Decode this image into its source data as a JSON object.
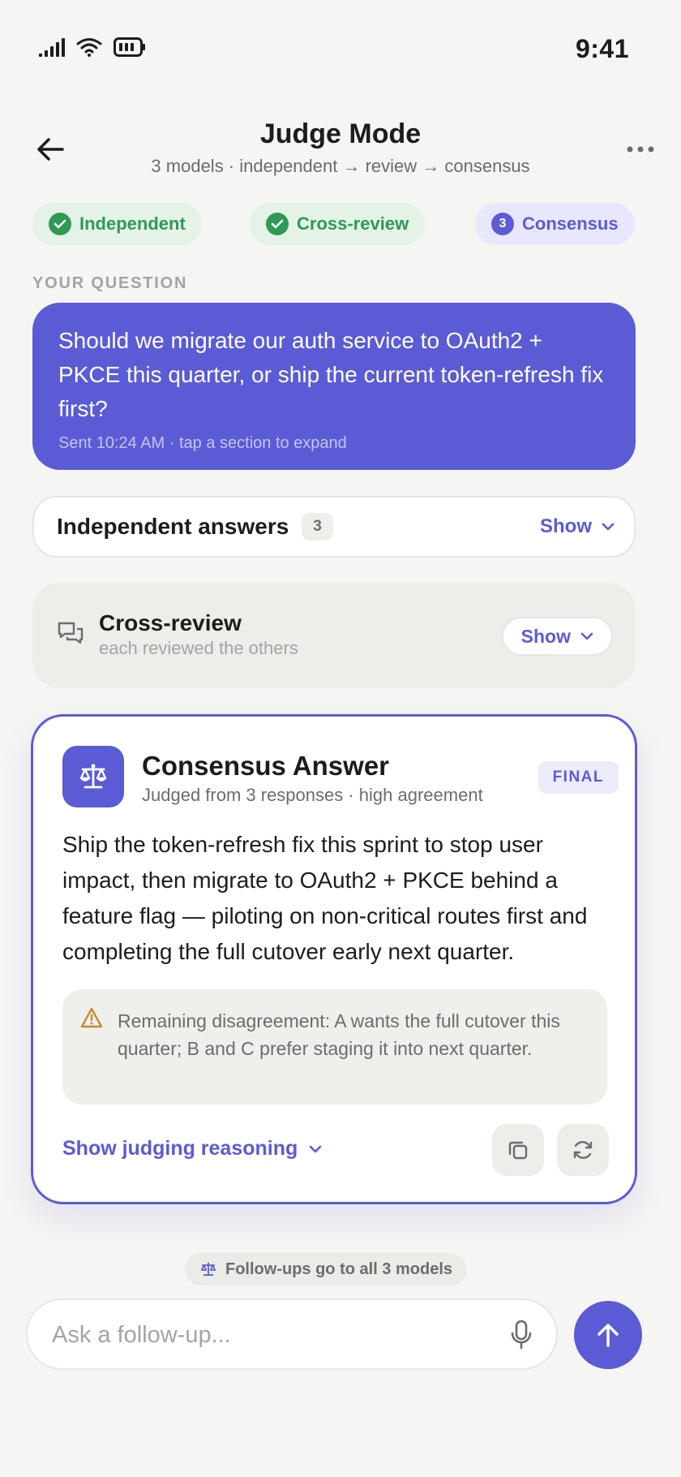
{
  "status_bar": {
    "time": "9:41"
  },
  "header": {
    "title": "Judge Mode",
    "subtitle": "3 models · independent → review → consensus"
  },
  "stepper": {
    "steps": [
      {
        "label": "Independent",
        "state": "done"
      },
      {
        "label": "Cross-review",
        "state": "done"
      },
      {
        "label": "Consensus",
        "state": "active",
        "number": "3"
      }
    ]
  },
  "question": {
    "section_label": "YOUR QUESTION",
    "text": "Should we migrate our auth service to OAuth2 + PKCE this quarter, or ship the current token-refresh fix first?",
    "meta": "Sent 10:24 AM · tap a section to expand"
  },
  "independent": {
    "title": "Independent answers",
    "count": "3",
    "show_label": "Show"
  },
  "cross_review": {
    "title": "Cross-review",
    "subtitle": "each reviewed the others",
    "show_label": "Show"
  },
  "consensus": {
    "title": "Consensus Answer",
    "subtitle": "Judged from 3 responses · high agreement",
    "badge": "FINAL",
    "body": "Ship the token-refresh fix this sprint to stop user impact, then migrate to OAuth2 + PKCE behind a feature flag — piloting on non-critical routes first and completing the full cutover early next quarter.",
    "disagreement": "Remaining disagreement: A wants the full cutover this quarter; B and C prefer staging it into next quarter.",
    "reasoning_label": "Show judging reasoning"
  },
  "followup": {
    "chip": "Follow-ups go to all 3 models",
    "placeholder": "Ask a follow-up..."
  },
  "colors": {
    "accent": "#5b5bd6",
    "success": "#2e9a55",
    "warning": "#c98a2e",
    "background": "#f5f5f3"
  },
  "icons": [
    "signal-icon",
    "wifi-icon",
    "battery-icon",
    "back-arrow-icon",
    "more-icon",
    "check-icon",
    "chat-bubbles-icon",
    "chevron-down-icon",
    "scale-icon",
    "warning-icon",
    "copy-icon",
    "refresh-icon",
    "mic-icon",
    "arrow-up-icon"
  ]
}
